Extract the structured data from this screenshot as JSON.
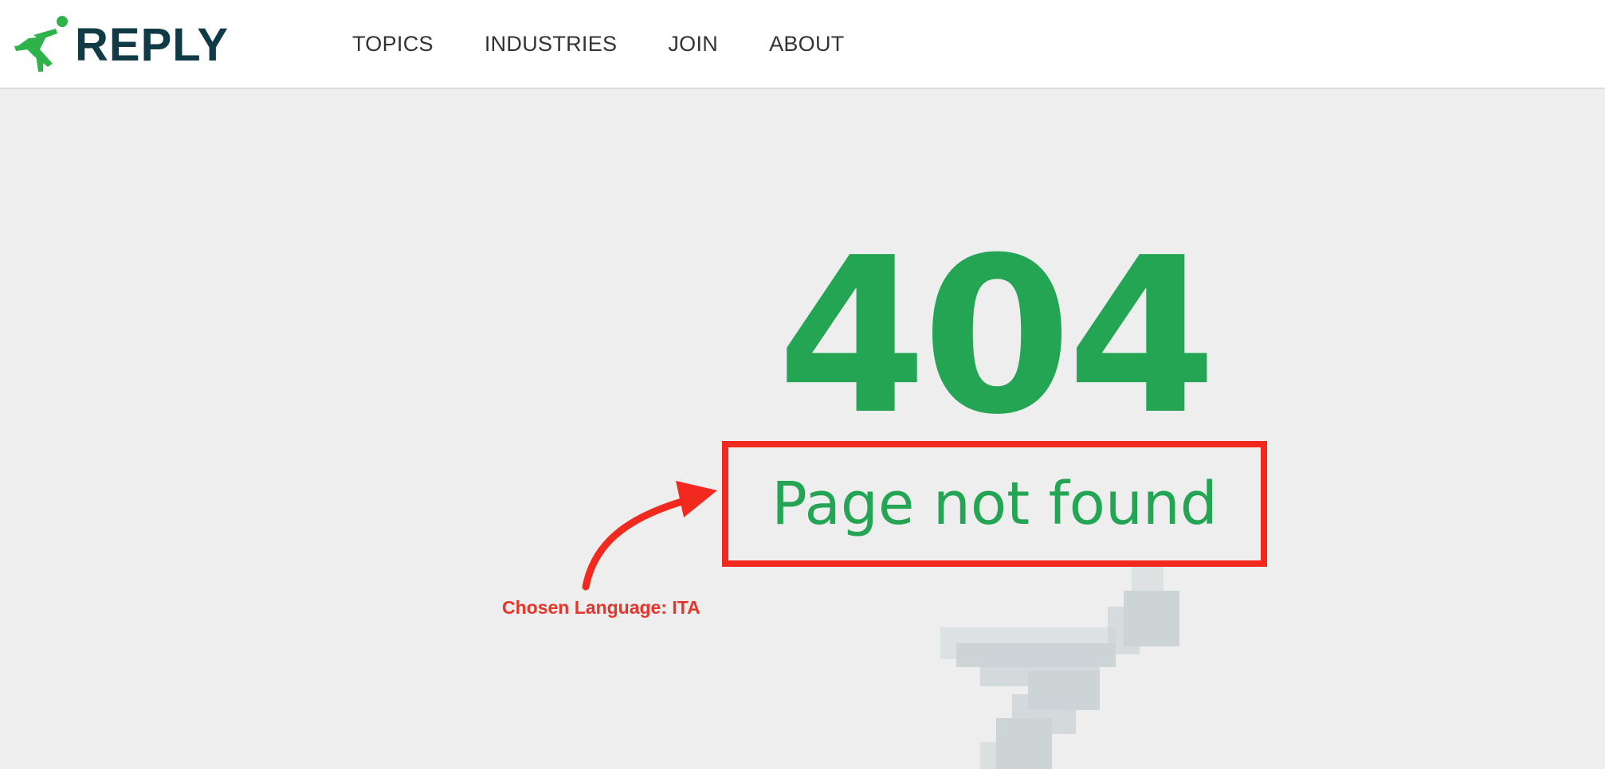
{
  "header": {
    "logo_text": "REPLY",
    "nav": [
      {
        "label": "TOPICS"
      },
      {
        "label": "INDUSTRIES"
      },
      {
        "label": "JOIN"
      },
      {
        "label": "ABOUT"
      }
    ]
  },
  "main": {
    "error_code": "404",
    "message": "Page not found"
  },
  "annotation": {
    "label": "Chosen Language: ITA"
  },
  "colors": {
    "brand_green": "#24a553",
    "brand_navy": "#0f3a46",
    "annotation_red": "#f2291e",
    "background": "#eeeeee"
  },
  "icons": {
    "logo": "runner-icon",
    "watermark": "pixelated-runner-icon",
    "annotation": "curved-arrow-icon"
  }
}
